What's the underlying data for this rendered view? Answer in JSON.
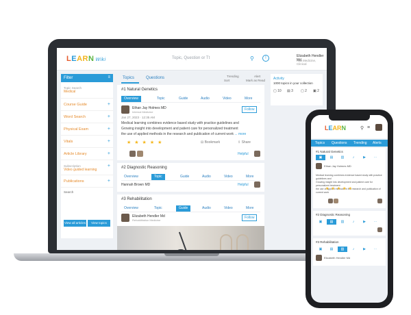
{
  "brand": {
    "l1": "L",
    "l2": "E",
    "l3": "AR",
    "l4": "N",
    "tagline": "Wiki"
  },
  "topbar": {
    "search_placeholder": "Topic, Question or Tt",
    "user_name": "Elizabeth Hendler Md",
    "user_sub": "Alta Medicine, Clinical"
  },
  "sidebar": {
    "header": "Filter",
    "toggle": "≡",
    "sections": [
      {
        "label": "Topic Search",
        "sub": "Search",
        "value": "Medical"
      },
      {
        "label": "Course Guide",
        "sub": "",
        "value": ""
      },
      {
        "label": "Word Search",
        "sub": "",
        "value": ""
      },
      {
        "label": "Physical Exam",
        "sub": "",
        "value": ""
      },
      {
        "label": "Vitals",
        "sub": "",
        "value": ""
      },
      {
        "label": "Article Library",
        "sub": "",
        "value": ""
      },
      {
        "label": "Subscription",
        "sub": "Video guided learning",
        "value": ""
      },
      {
        "label": "Publications",
        "sub": "",
        "value": ""
      }
    ],
    "section_label": "Search",
    "btn_left": "View all articles",
    "btn_right": "View topics"
  },
  "tabs": {
    "topics": "Topics",
    "questions": "Questions",
    "sort1": "Trending",
    "sort1b": "Sort",
    "sort2": "Alert",
    "sort2b": "Mark as Read"
  },
  "posts": [
    {
      "title": "#1 Natural Genetics",
      "tabs": [
        "Overview",
        "Topic",
        "Guide",
        "Audio",
        "Video",
        "More"
      ],
      "author": "Ethan Jay Holmes MD",
      "author_sub": "Internal Medicine",
      "follow": "Follow",
      "meta": "Jan 27, 2023 · 12:35 AM",
      "body": [
        "Medical learning combines evidence based study with practice guidelines and",
        "Growing insight into development and patient care for personalized treatment",
        "the use of applied methods in the research and publication of current work"
      ],
      "more": "... more",
      "bookmark": "Bookmark",
      "share": "Share",
      "helpful": "Helpful"
    },
    {
      "title": "#2 Diagnostic Reasoning",
      "tabs": [
        "Overview",
        "Topic",
        "Guide",
        "Audio",
        "Video",
        "More"
      ],
      "author": "Hannah Brown MD",
      "helpful": "Helpful"
    },
    {
      "title": "#3 Rehabilitation",
      "tabs": [
        "Overview",
        "Topic",
        "Guide",
        "Audio",
        "Video",
        "More"
      ],
      "author": "Elizabeth Hendler Md",
      "author_sub": "Rehabilitation Medicine",
      "follow": "Follow"
    }
  ],
  "right_panel": {
    "title": "Activity",
    "subtitle": "1000 topics in your collection",
    "stats": [
      "10",
      "3",
      "2",
      "2"
    ]
  },
  "phone": {
    "tabs": [
      "Topics",
      "Questions",
      "Trending",
      "Alerts"
    ],
    "cards": [
      {
        "title": "#1 Natural Genetics"
      },
      {
        "title": "#2 Diagnostic Reasoning"
      },
      {
        "title": "#3 Rehabilitation"
      }
    ]
  }
}
